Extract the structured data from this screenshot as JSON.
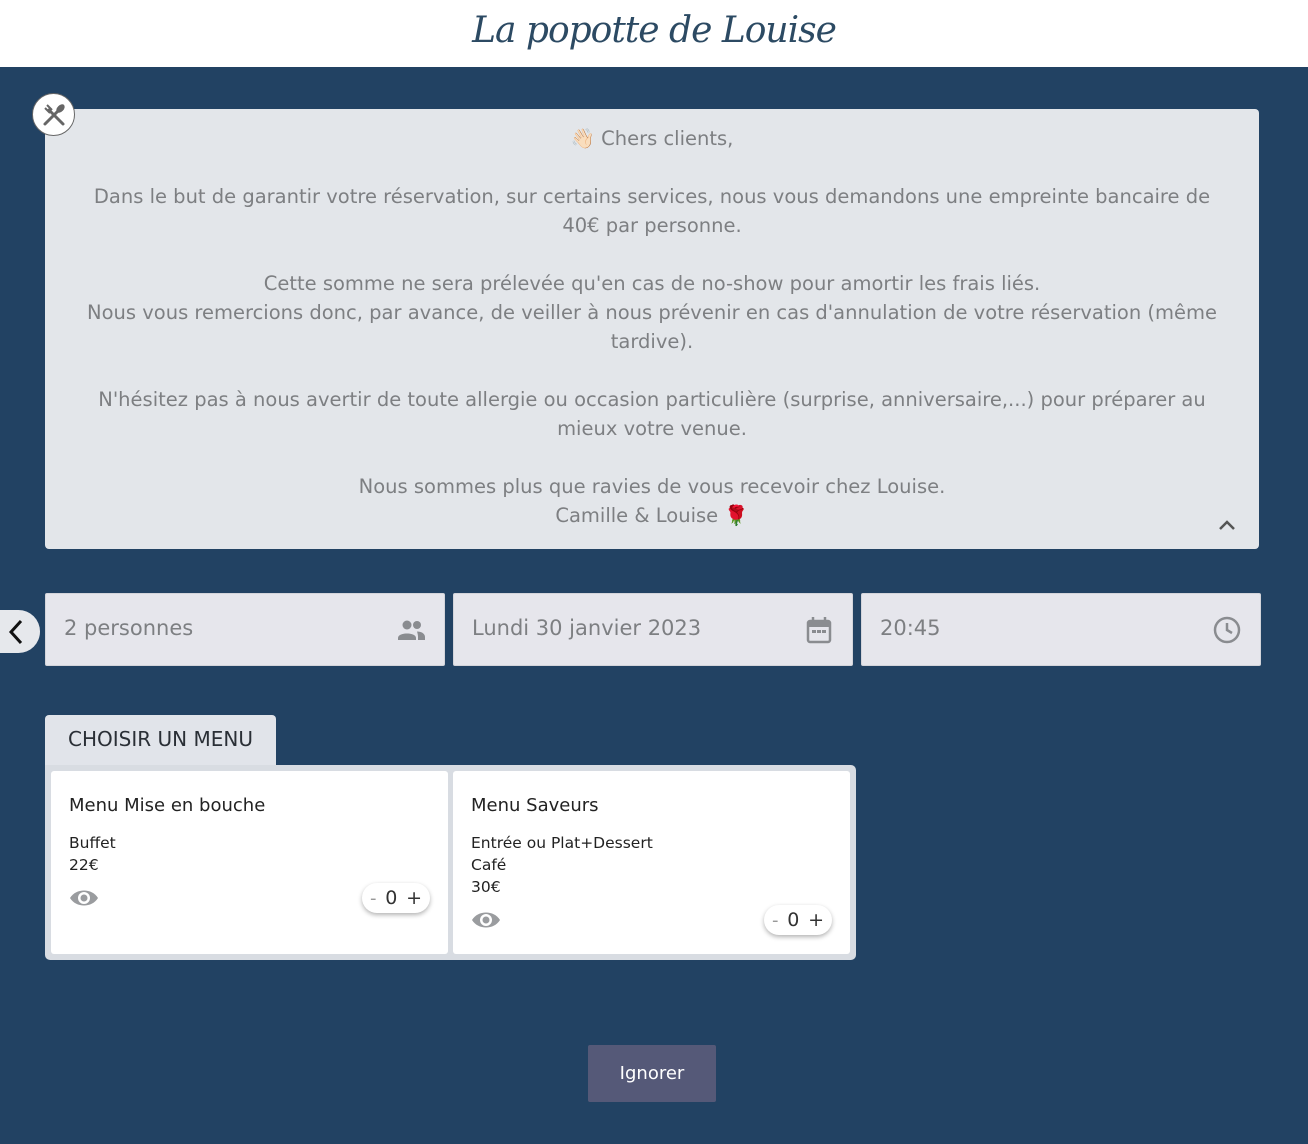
{
  "header": {
    "logo_text": "La popotte de Louise"
  },
  "info": {
    "lines": [
      "👋🏻 Chers clients,",
      "",
      "Dans le but de garantir votre réservation, sur certains services, nous vous demandons une empreinte bancaire de 40€ par personne.",
      "",
      "Cette somme ne sera prélevée qu'en cas de no-show pour amortir les frais liés.",
      "Nous vous remercions donc, par avance, de veiller à nous prévenir en cas d'annulation de votre réservation (même tardive).",
      "",
      "N'hésitez pas à nous avertir de toute allergie ou occasion particulière (surprise, anniversaire,...) pour préparer au mieux votre venue.",
      "",
      "Nous sommes plus que ravies de vous recevoir chez Louise.",
      "Camille & Louise 🌹"
    ]
  },
  "fields": {
    "people": "2 personnes",
    "date": "Lundi 30 janvier 2023",
    "time": "20:45"
  },
  "menu_tab": {
    "label": "CHOISIR UN MENU"
  },
  "menus": [
    {
      "name": "Menu Mise en bouche",
      "desc": [
        "Buffet",
        "22€"
      ],
      "qty": "0"
    },
    {
      "name": "Menu Saveurs",
      "desc": [
        "Entrée ou Plat+Dessert",
        "Café",
        "30€"
      ],
      "qty": "0"
    }
  ],
  "stepper": {
    "minus": "-",
    "plus": "+"
  },
  "actions": {
    "ignore_label": "Ignorer"
  },
  "icons": {
    "close": "fork-knife-close-icon",
    "collapse": "chevron-up-icon",
    "back": "chevron-left-icon",
    "people": "group-icon",
    "date": "calendar-icon",
    "time": "clock-icon",
    "view": "eye-icon"
  },
  "colors": {
    "background": "#224263",
    "info_box": "#e3e6ea",
    "button": "#555978"
  }
}
